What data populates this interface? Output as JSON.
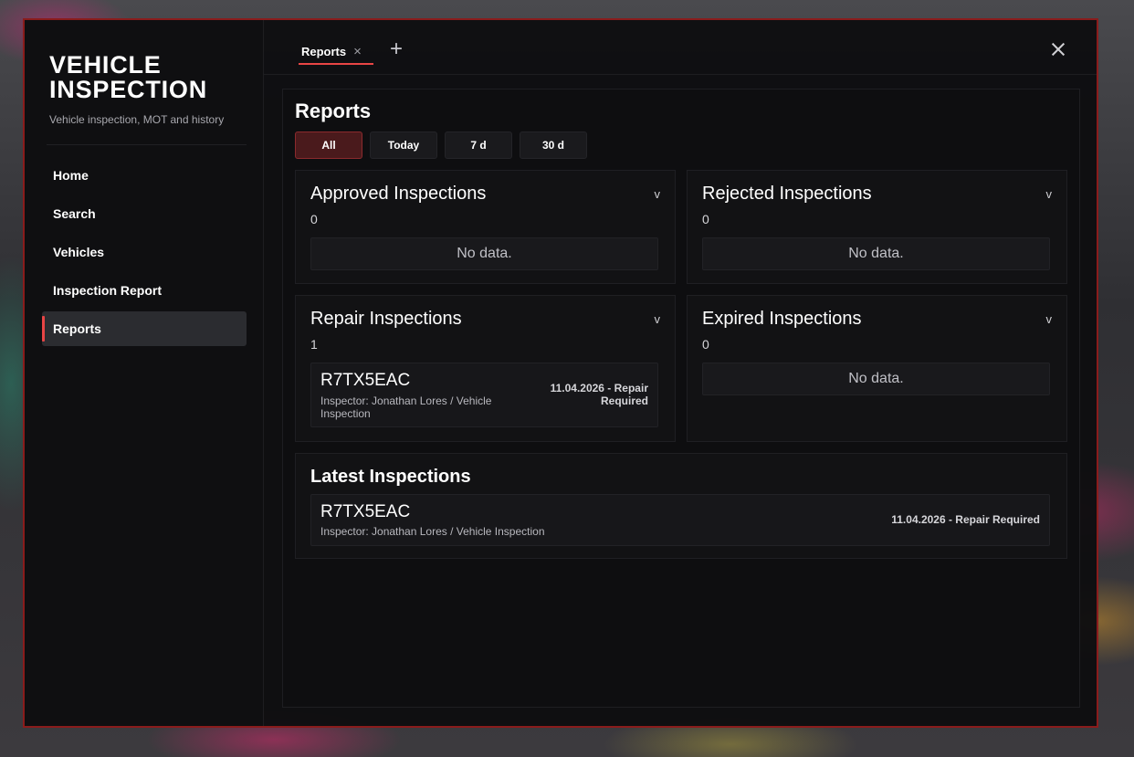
{
  "app": {
    "title": "VEHICLE INSPECTION",
    "subtitle": "Vehicle inspection, MOT and history"
  },
  "sidebar": {
    "items": [
      {
        "label": "Home"
      },
      {
        "label": "Search"
      },
      {
        "label": "Vehicles"
      },
      {
        "label": "Inspection Report"
      },
      {
        "label": "Reports",
        "active": true
      }
    ]
  },
  "tabs": {
    "items": [
      {
        "label": "Reports",
        "close": "×"
      }
    ],
    "add": "+"
  },
  "reports": {
    "title": "Reports",
    "filters": [
      "All",
      "Today",
      "7 d",
      "30 d"
    ],
    "active_filter": "All",
    "chevron": "v",
    "approved": {
      "title": "Approved Inspections",
      "count": "0",
      "empty": "No data."
    },
    "rejected": {
      "title": "Rejected Inspections",
      "count": "0",
      "empty": "No data."
    },
    "repair": {
      "title": "Repair Inspections",
      "count": "1",
      "entries": [
        {
          "plate": "R7TX5EAC",
          "inspector": "Inspector: Jonathan Lores / Vehicle Inspection",
          "status": "11.04.2026 - Repair Required"
        }
      ]
    },
    "expired": {
      "title": "Expired Inspections",
      "count": "0",
      "empty": "No data."
    },
    "latest": {
      "title": "Latest Inspections",
      "entries": [
        {
          "plate": "R7TX5EAC",
          "inspector": "Inspector: Jonathan Lores / Vehicle Inspection",
          "status": "11.04.2026 - Repair Required"
        }
      ]
    }
  },
  "colors": {
    "accent": "#e84545",
    "border": "#8a1c1c",
    "active_filter_bg": "#4a1a1c"
  }
}
